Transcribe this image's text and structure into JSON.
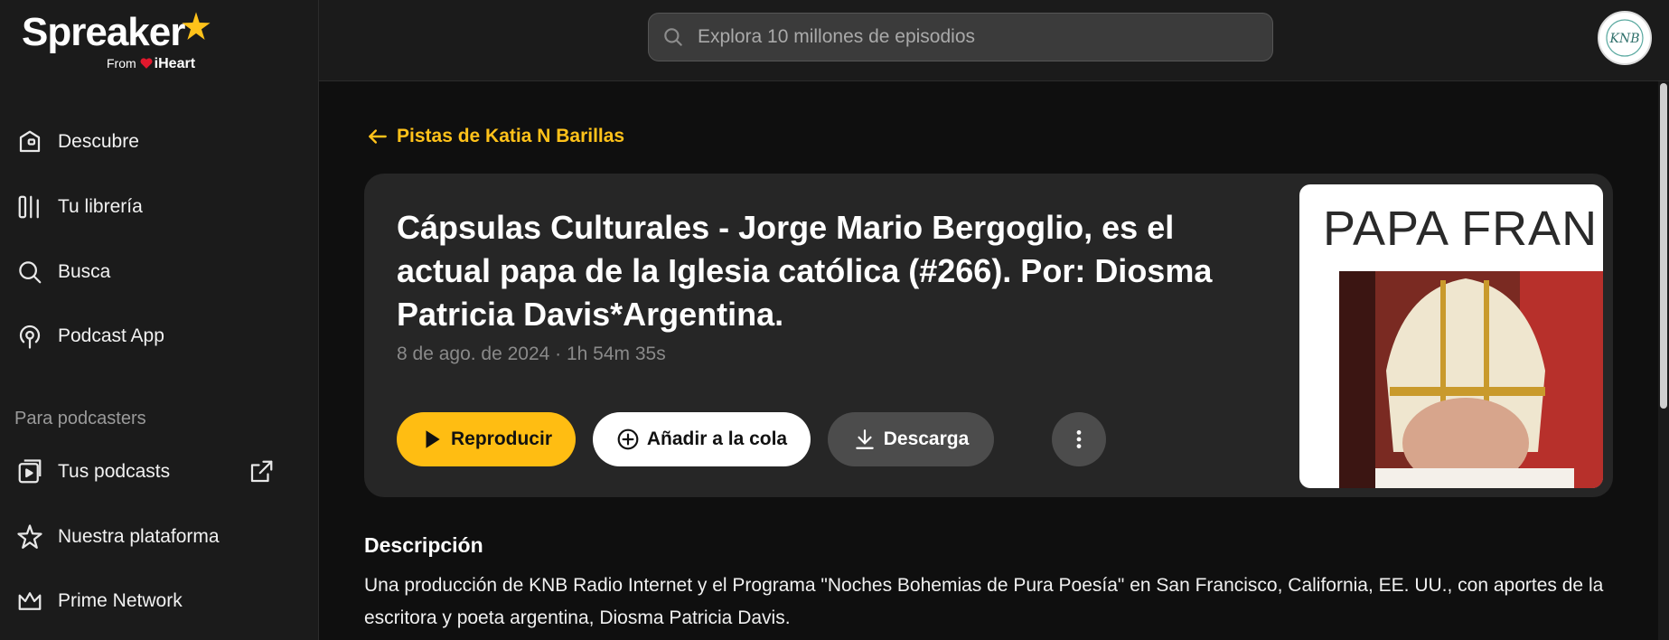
{
  "brand": {
    "name": "Spreaker",
    "from_text": "From",
    "partner": "iHeart",
    "accent_color": "#ffc21a"
  },
  "search": {
    "placeholder": "Explora 10 millones de episodios",
    "icon": "search-icon"
  },
  "sidebar": {
    "items": [
      {
        "label": "Descubre",
        "icon": "home-icon"
      },
      {
        "label": "Tu librería",
        "icon": "library-icon"
      },
      {
        "label": "Busca",
        "icon": "search-icon"
      },
      {
        "label": "Podcast App",
        "icon": "podcast-app-icon"
      }
    ],
    "section_label": "Para podcasters",
    "podcaster_items": [
      {
        "label": "Tus podcasts",
        "icon": "podcasts-icon",
        "external": true
      },
      {
        "label": "Nuestra plataforma",
        "icon": "star-icon"
      },
      {
        "label": "Prime Network",
        "icon": "crown-icon"
      }
    ]
  },
  "episode": {
    "back_label": "Pistas de Katia N Barillas",
    "title": "Cápsulas Culturales - Jorge Mario Bergoglio, es el actual papa de la Iglesia católica (#266). Por: Diosma Patricia Davis*Argentina.",
    "meta": "8 de ago. de 2024 · 1h 54m 35s",
    "cover_text": "PAPA FRAN",
    "buttons": {
      "play": "Reproducir",
      "queue": "Añadir a la cola",
      "download": "Descarga"
    }
  },
  "description": {
    "heading": "Descripción",
    "text": "Una producción de KNB Radio Internet y el Programa \"Noches Bohemias de Pura Poesía\" en San Francisco, California, EE. UU., con aportes de la escritora y poeta argentina, Diosma Patricia Davis."
  },
  "user": {
    "avatar_text": "KNB"
  }
}
